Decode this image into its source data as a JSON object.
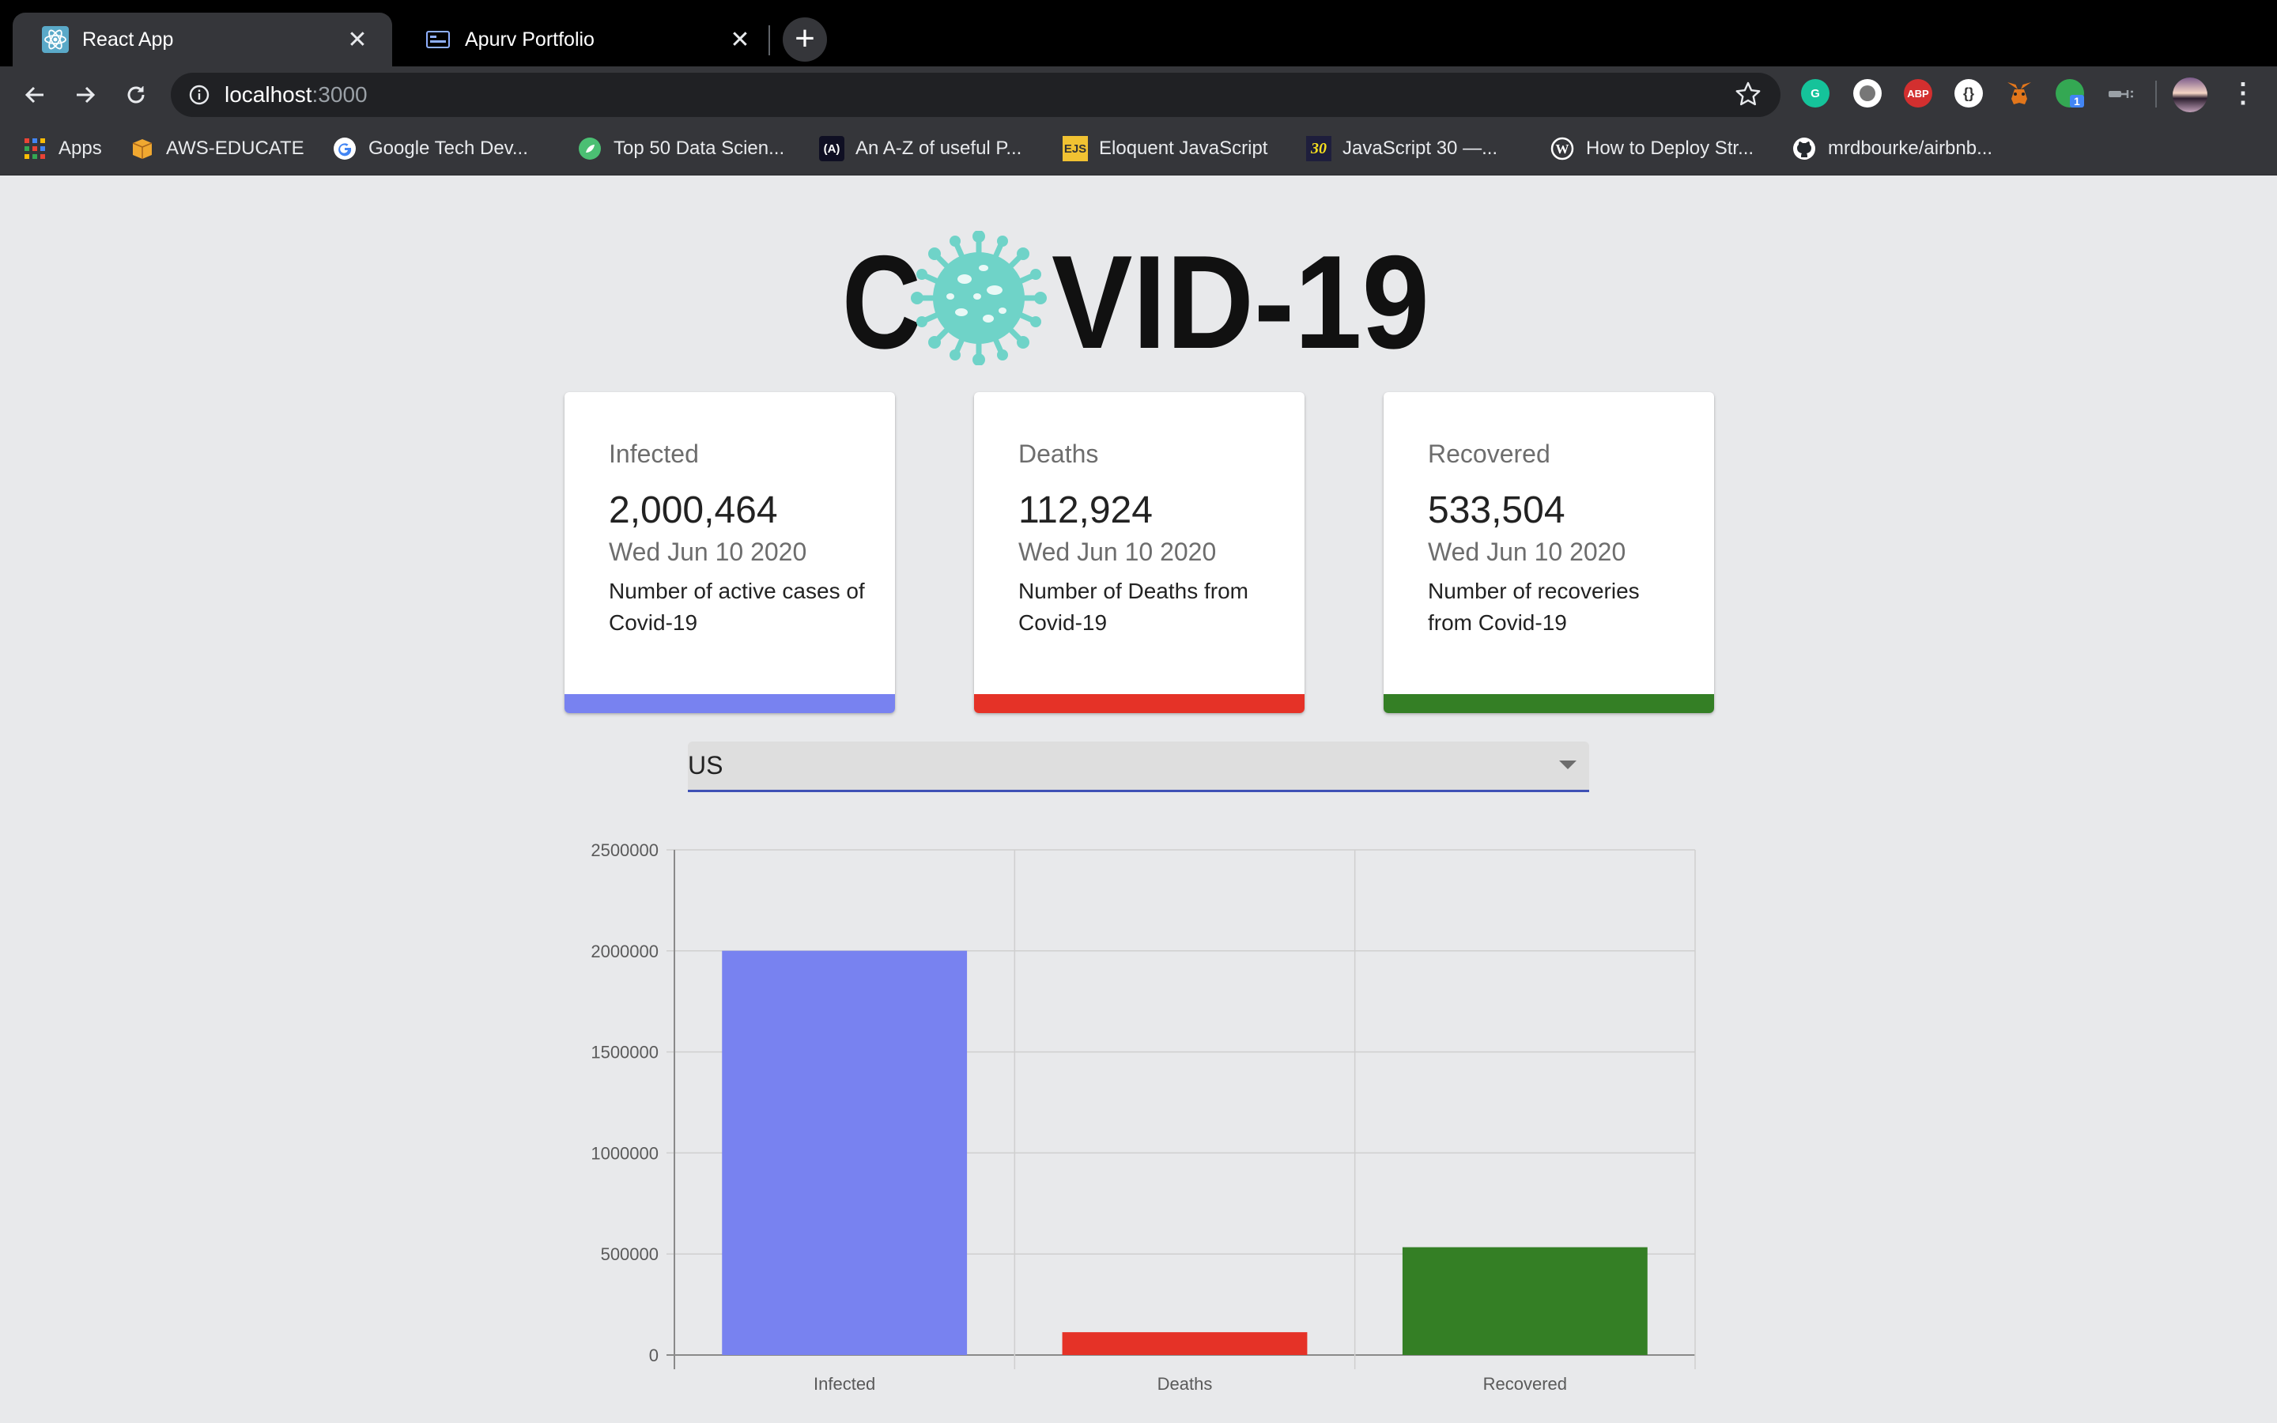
{
  "browser": {
    "tabs": [
      {
        "title": "React App",
        "icon": "react-icon",
        "active": true
      },
      {
        "title": "Apurv Portfolio",
        "icon": "portfolio-icon",
        "active": false
      }
    ],
    "url_host": "localhost",
    "url_port": ":3000",
    "bookmarks": [
      {
        "label": "Apps",
        "icon": "apps-grid-icon"
      },
      {
        "label": "AWS-EDUCATE",
        "icon": "aws-box-icon"
      },
      {
        "label": "Google Tech Dev...",
        "icon": "google-icon"
      },
      {
        "label": "Top 50 Data Scien...",
        "icon": "leaf-icon"
      },
      {
        "label": "An A-Z of useful P...",
        "icon": "angular-icon"
      },
      {
        "label": "Eloquent JavaScript",
        "icon": "ejs-icon"
      },
      {
        "label": "JavaScript 30 —...",
        "icon": "js30-icon"
      },
      {
        "label": "How to Deploy Str...",
        "icon": "wordpress-icon"
      },
      {
        "label": "mrdbourke/airbnb...",
        "icon": "github-icon"
      }
    ],
    "extensions": {
      "abp_label": "ABP",
      "badge_count": "1"
    }
  },
  "app": {
    "logo": {
      "left": "C",
      "right": "VID-19",
      "virus_color": "#6fd3c8"
    },
    "cards": [
      {
        "title": "Infected",
        "value": "2,000,464",
        "date": "Wed Jun 10 2020",
        "description": "Number of active cases of Covid-19",
        "color": "#7882f0"
      },
      {
        "title": "Deaths",
        "value": "112,924",
        "date": "Wed Jun 10 2020",
        "description": "Number of Deaths from Covid-19",
        "color": "#e53227"
      },
      {
        "title": "Recovered",
        "value": "533,504",
        "date": "Wed Jun 10 2020",
        "description": "Number of recoveries from Covid-19",
        "color": "#347f25"
      }
    ],
    "country_select": {
      "value": "US",
      "accent": "#3f51b5"
    }
  },
  "chart_data": {
    "type": "bar",
    "categories": [
      "Infected",
      "Deaths",
      "Recovered"
    ],
    "values": [
      2000464,
      112924,
      533504
    ],
    "colors": [
      "#7882f0",
      "#e53227",
      "#347f25"
    ],
    "ylim": [
      0,
      2500000
    ],
    "yticks": [
      "0",
      "500000",
      "1000000",
      "1500000",
      "2000000",
      "2500000"
    ],
    "grid": true,
    "legend": "none"
  }
}
